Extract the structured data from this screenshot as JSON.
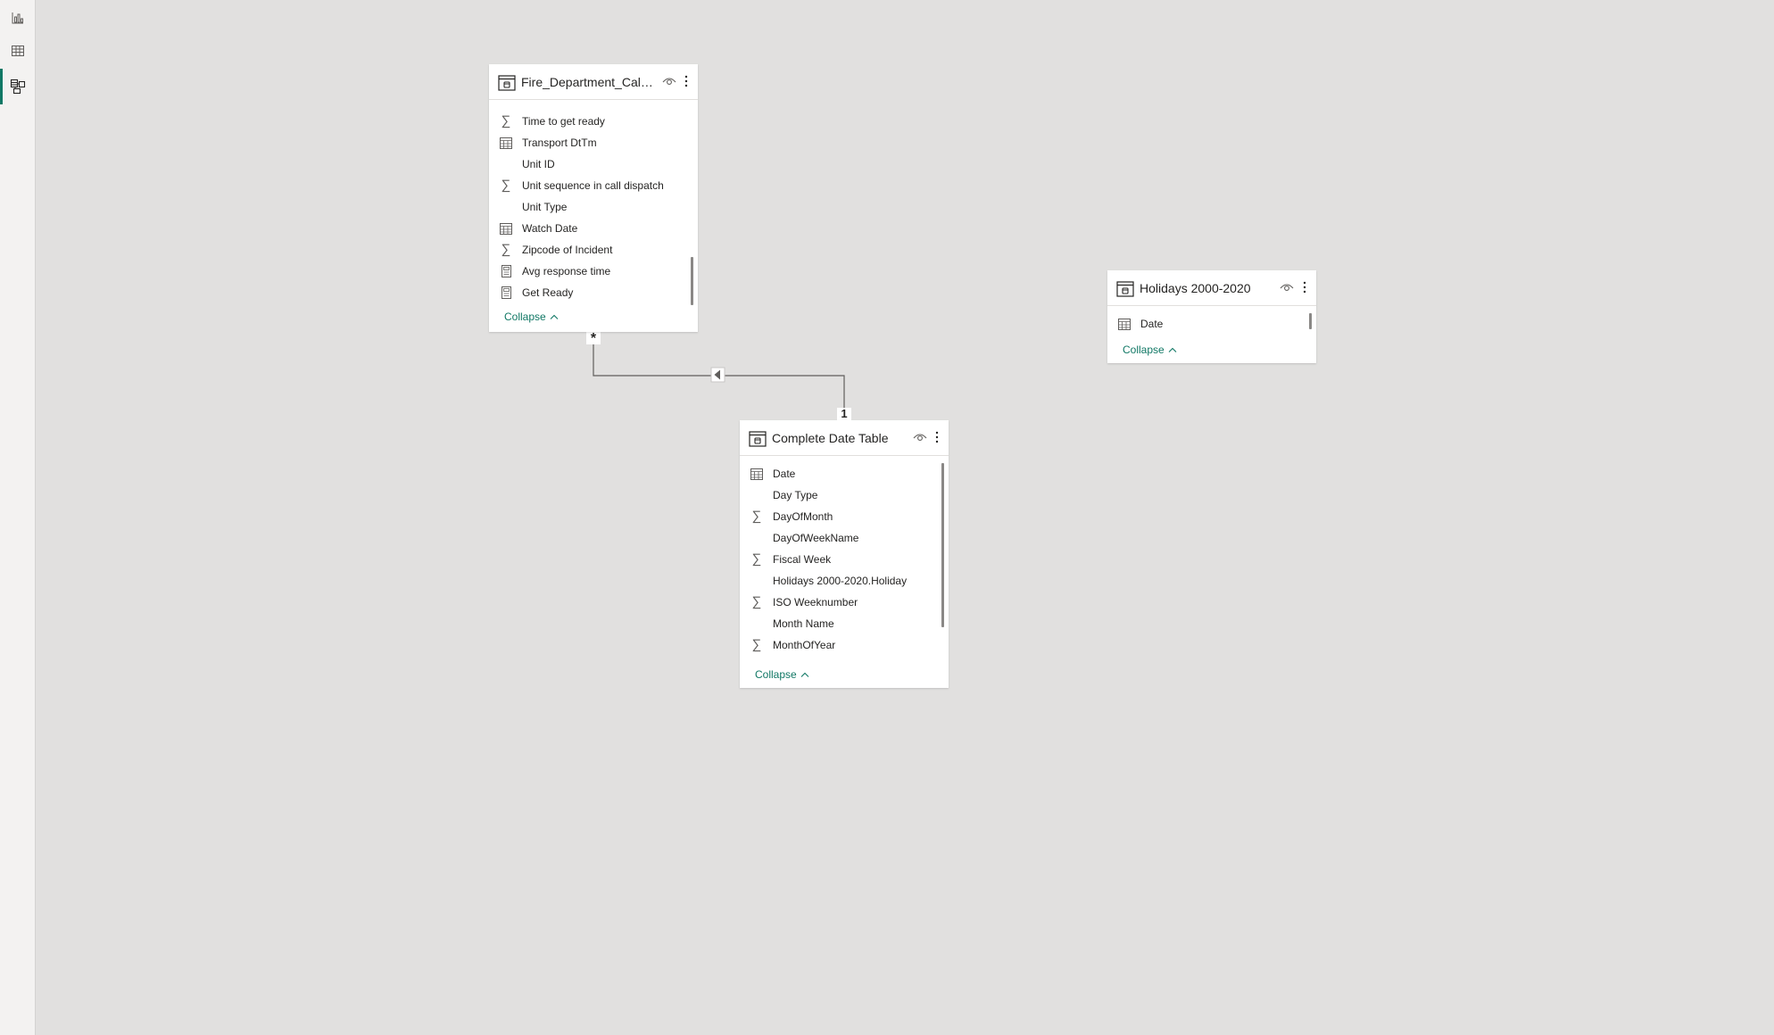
{
  "nav": {
    "items": [
      {
        "name": "report-view",
        "icon": "bar-chart-icon",
        "active": false
      },
      {
        "name": "data-view",
        "icon": "table-grid-icon",
        "active": false
      },
      {
        "name": "model-view",
        "icon": "model-icon",
        "active": true
      }
    ],
    "accent_color": "#117865"
  },
  "tables": {
    "fire": {
      "title": "Fire_Department_Call...",
      "collapse_label": "Collapse",
      "fields": [
        {
          "icon": "sigma-icon",
          "label": "Time to get ready"
        },
        {
          "icon": "calendar-icon",
          "label": "Transport DtTm"
        },
        {
          "icon": "none",
          "label": "Unit ID"
        },
        {
          "icon": "sigma-icon",
          "label": "Unit sequence in call dispatch"
        },
        {
          "icon": "none",
          "label": "Unit Type"
        },
        {
          "icon": "calendar-icon",
          "label": "Watch Date"
        },
        {
          "icon": "sigma-icon",
          "label": "Zipcode of Incident"
        },
        {
          "icon": "calculator-icon",
          "label": "Avg response time"
        },
        {
          "icon": "calculator-icon",
          "label": "Get Ready"
        }
      ]
    },
    "holidays": {
      "title": "Holidays 2000-2020",
      "collapse_label": "Collapse",
      "fields": [
        {
          "icon": "calendar-icon",
          "label": "Date"
        }
      ]
    },
    "date": {
      "title": "Complete Date Table",
      "collapse_label": "Collapse",
      "fields": [
        {
          "icon": "calendar-icon",
          "label": "Date"
        },
        {
          "icon": "none",
          "label": "Day Type"
        },
        {
          "icon": "sigma-icon",
          "label": "DayOfMonth"
        },
        {
          "icon": "none",
          "label": "DayOfWeekName"
        },
        {
          "icon": "sigma-icon",
          "label": "Fiscal Week"
        },
        {
          "icon": "none",
          "label": "Holidays 2000-2020.Holiday"
        },
        {
          "icon": "sigma-icon",
          "label": "ISO Weeknumber"
        },
        {
          "icon": "none",
          "label": "Month Name"
        },
        {
          "icon": "sigma-icon",
          "label": "MonthOfYear"
        }
      ]
    }
  },
  "relationship": {
    "many_label": "*",
    "one_label": "1",
    "direction": "single",
    "from": "Fire_Department_Call...",
    "to": "Complete Date Table"
  }
}
